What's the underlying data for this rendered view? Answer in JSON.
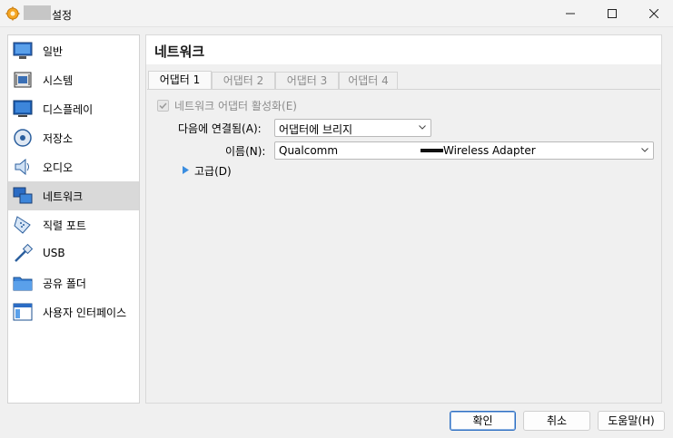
{
  "window": {
    "title": "설정",
    "icon": "virtualbox-gear-icon"
  },
  "sidebar": {
    "items": [
      {
        "label": "일반",
        "icon": "monitor-icon"
      },
      {
        "label": "시스템",
        "icon": "chip-icon"
      },
      {
        "label": "디스플레이",
        "icon": "display-icon"
      },
      {
        "label": "저장소",
        "icon": "disk-icon"
      },
      {
        "label": "오디오",
        "icon": "speaker-icon"
      },
      {
        "label": "네트워크",
        "icon": "network-icon"
      },
      {
        "label": "직렬 포트",
        "icon": "serial-port-icon"
      },
      {
        "label": "USB",
        "icon": "usb-icon"
      },
      {
        "label": "공유 폴더",
        "icon": "folder-icon"
      },
      {
        "label": "사용자 인터페이스",
        "icon": "ui-window-icon"
      }
    ],
    "selected": "네트워크"
  },
  "main": {
    "title": "네트워크",
    "tabs": [
      "어댑터 1",
      "어댑터 2",
      "어댑터 3",
      "어댑터 4"
    ],
    "active_tab": "어댑터 1",
    "enable_checkbox_label": "네트워크 어댑터 활성화(E)",
    "enable_checked": true,
    "attached_label": "다음에 연결됨(A):",
    "attached_value": "어댑터에 브리지",
    "name_label": "이름(N):",
    "name_value_prefix": "Qualcomm",
    "name_value_suffix": "Wireless Adapter",
    "advanced_label": "고급(D)"
  },
  "buttons": {
    "ok": "확인",
    "cancel": "취소",
    "help": "도움말(H)"
  },
  "colors": {
    "accent": "#2e6fc2",
    "selected_bg": "#d9d9d9"
  }
}
